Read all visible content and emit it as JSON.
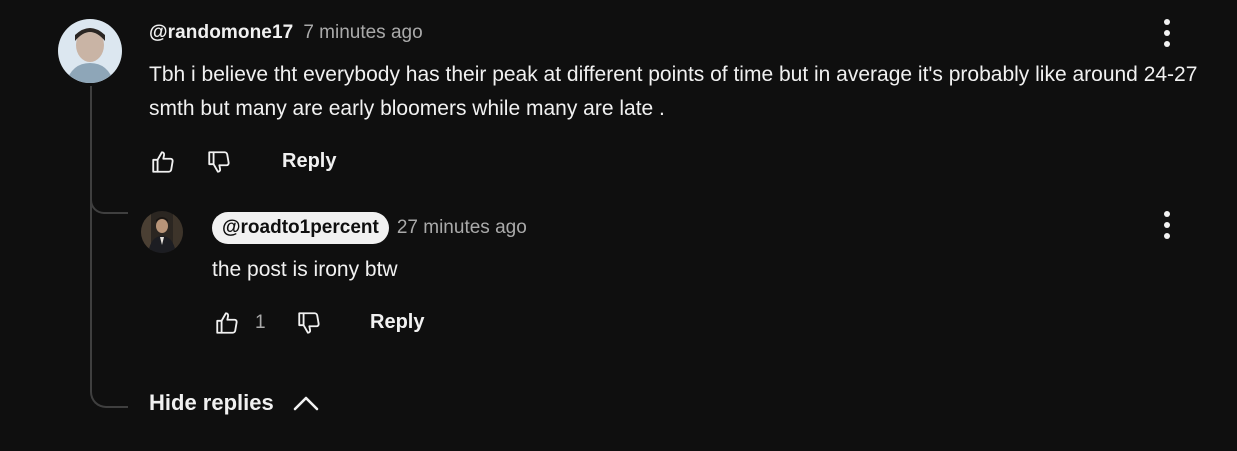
{
  "comment": {
    "author": "@randomone17",
    "time": "7 minutes ago",
    "text": "Tbh i believe tht everybody has their peak at different points of time but in average it's probably like around 24-27 smth but many are early bloomers while many are late .",
    "reply_label": "Reply",
    "icons": {
      "like": "thumbs-up-icon",
      "dislike": "thumbs-down-icon",
      "more": "more-vert-icon"
    }
  },
  "reply": {
    "author": "@roadto1percent",
    "time": "27 minutes ago",
    "text": "the post is irony btw",
    "like_count": "1",
    "reply_label": "Reply",
    "icons": {
      "like": "thumbs-up-icon",
      "dislike": "thumbs-down-icon",
      "more": "more-vert-icon"
    }
  },
  "replies_toggle": {
    "label": "Hide replies",
    "icon": "chevron-up-icon"
  },
  "colors": {
    "background": "#0f0f0f",
    "text": "#f1f1f1",
    "secondary": "#aaaaaa",
    "chip": "#f1f1f1"
  }
}
